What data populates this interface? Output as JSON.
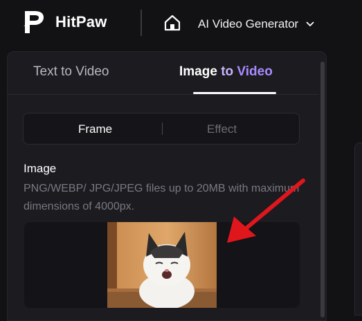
{
  "header": {
    "brand": "HitPaw",
    "generator_label": "AI Video Generator",
    "icons": {
      "logo": "hitpaw-logo-icon",
      "home": "home-icon",
      "dropdown": "chevron-down-icon"
    }
  },
  "tabs": [
    {
      "label": "Text to Video",
      "active": false
    },
    {
      "label_parts": [
        "Image",
        "to",
        "Video"
      ],
      "active": true
    }
  ],
  "segment": {
    "items": [
      {
        "label": "Frame",
        "active": true
      },
      {
        "label": "Effect",
        "active": false
      }
    ]
  },
  "image_upload": {
    "title": "Image",
    "description": "PNG/WEBP/ JPG/JPEG files up to 20MB with maximum dimensions of 4000px."
  },
  "colors": {
    "background": "#121214",
    "panel": "#1c1b20",
    "accent_purple": "#a98bff",
    "annotation_red": "#e0161d"
  }
}
